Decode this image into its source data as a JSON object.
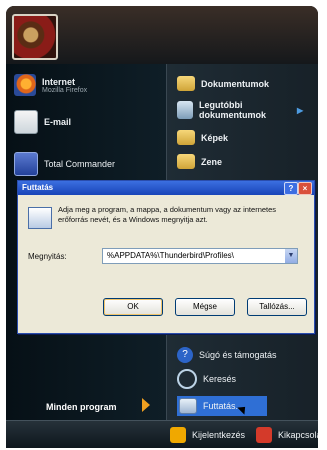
{
  "left_items": {
    "internet": {
      "label": "Internet",
      "sub": "Mozilla Firefox"
    },
    "email": {
      "label": "E-mail"
    },
    "total_commander": {
      "label": "Total Commander"
    }
  },
  "right_items": {
    "documents": "Dokumentumok",
    "recent_docs": "Legutóbbi dokumentumok",
    "pictures": "Képek",
    "music": "Zene",
    "help": "Súgó és támogatás",
    "search": "Keresés",
    "run": "Futtatás..."
  },
  "all_programs": "Minden program",
  "bottom": {
    "logoff": "Kijelentkezés",
    "shutdown": "Kikapcsolás"
  },
  "dialog": {
    "title": "Futtatás",
    "help_glyph": "?",
    "close_glyph": "×",
    "description": "Adja meg a program, a mappa, a dokumentum vagy az internetes erőforrás nevét, és a Windows megnyitja azt.",
    "open_label": "Megnyitás:",
    "open_value": "%APPDATA%\\Thunderbird\\Profiles\\",
    "ok": "OK",
    "cancel": "Mégse",
    "browse": "Tallózás..."
  }
}
